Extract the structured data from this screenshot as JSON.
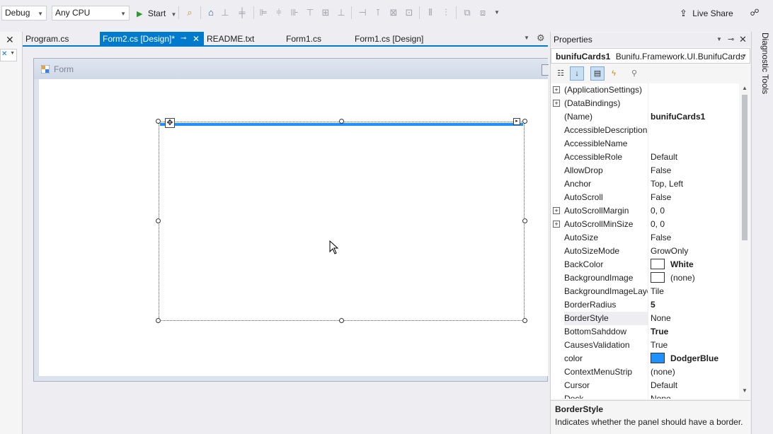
{
  "toolbar": {
    "config": "Debug",
    "platform": "Any CPU",
    "start_label": "Start",
    "live_share": "Live Share"
  },
  "tabs": [
    {
      "label": "Program.cs"
    },
    {
      "label": "Form2.cs [Design]*"
    },
    {
      "label": "README.txt"
    },
    {
      "label": "Form1.cs"
    },
    {
      "label": "Form1.cs [Design]"
    }
  ],
  "designer": {
    "form_title": "Form"
  },
  "properties": {
    "panel_title": "Properties",
    "object_name": "bunifuCards1",
    "object_type": "Bunifu.Framework.UI.BunifuCards",
    "rows": [
      {
        "name": "(ApplicationSettings)",
        "value": "",
        "expand": true
      },
      {
        "name": "(DataBindings)",
        "value": "",
        "expand": true
      },
      {
        "name": "(Name)",
        "value": "bunifuCards1",
        "bold": true
      },
      {
        "name": "AccessibleDescription",
        "value": ""
      },
      {
        "name": "AccessibleName",
        "value": ""
      },
      {
        "name": "AccessibleRole",
        "value": "Default"
      },
      {
        "name": "AllowDrop",
        "value": "False"
      },
      {
        "name": "Anchor",
        "value": "Top, Left"
      },
      {
        "name": "AutoScroll",
        "value": "False"
      },
      {
        "name": "AutoScrollMargin",
        "value": "0, 0",
        "expand": true
      },
      {
        "name": "AutoScrollMinSize",
        "value": "0, 0",
        "expand": true
      },
      {
        "name": "AutoSize",
        "value": "False"
      },
      {
        "name": "AutoSizeMode",
        "value": "GrowOnly"
      },
      {
        "name": "BackColor",
        "value": "White",
        "bold": true,
        "swatch": "#ffffff"
      },
      {
        "name": "BackgroundImage",
        "value": "(none)",
        "swatch": "#ffffff"
      },
      {
        "name": "BackgroundImageLayout",
        "value": "Tile"
      },
      {
        "name": "BorderRadius",
        "value": "5",
        "bold": true
      },
      {
        "name": "BorderStyle",
        "value": "None",
        "selected": true
      },
      {
        "name": "BottomSahddow",
        "value": "True",
        "bold": true
      },
      {
        "name": "CausesValidation",
        "value": "True"
      },
      {
        "name": "color",
        "value": "DodgerBlue",
        "bold": true,
        "swatch": "#1e90ff"
      },
      {
        "name": "ContextMenuStrip",
        "value": "(none)"
      },
      {
        "name": "Cursor",
        "value": "Default"
      },
      {
        "name": "Dock",
        "value": "None"
      }
    ],
    "description_title": "BorderStyle",
    "description_text": "Indicates whether the panel should have a border."
  },
  "right_panel": {
    "label": "Diagnostic Tools"
  },
  "colors": {
    "accent": "#007acc",
    "card_bar": "#1e90ff"
  }
}
